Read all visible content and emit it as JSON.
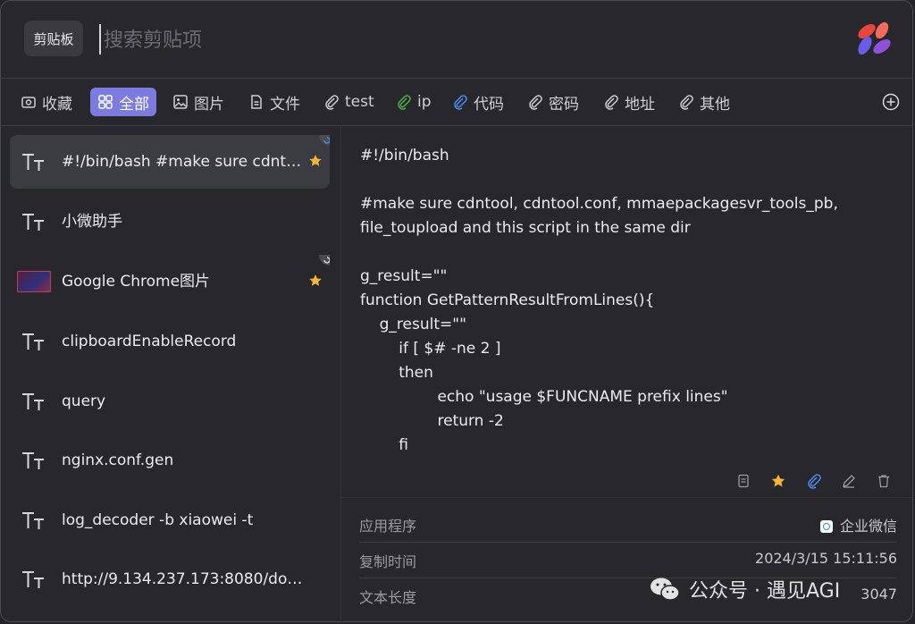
{
  "topbar": {
    "clipboard_chip": "剪贴板",
    "search_placeholder": "搜索剪贴项"
  },
  "tabs": [
    {
      "label": "收藏",
      "icon": "camera-icon"
    },
    {
      "label": "全部",
      "icon": "grid-icon",
      "active": true
    },
    {
      "label": "图片",
      "icon": "image-icon"
    },
    {
      "label": "文件",
      "icon": "file-icon"
    },
    {
      "label": "test",
      "icon": "paperclip-icon"
    },
    {
      "label": "ip",
      "icon": "paperclip-icon",
      "color": "#4caf50"
    },
    {
      "label": "代码",
      "icon": "paperclip-icon",
      "color": "#4a8df0"
    },
    {
      "label": "密码",
      "icon": "paperclip-icon"
    },
    {
      "label": "地址",
      "icon": "paperclip-icon"
    },
    {
      "label": "其他",
      "icon": "paperclip-icon"
    }
  ],
  "list": [
    {
      "label": "#!/bin/bash #make sure cdntool…",
      "icon": "text-icon",
      "starred": true,
      "selected": true
    },
    {
      "label": "小微助手",
      "icon": "text-icon"
    },
    {
      "label": "Google Chrome图片",
      "icon": "image-thumb",
      "starred": true
    },
    {
      "label": "clipboardEnableRecord",
      "icon": "text-icon"
    },
    {
      "label": "query",
      "icon": "text-icon"
    },
    {
      "label": "nginx.conf.gen",
      "icon": "text-icon"
    },
    {
      "label": "log_decoder -b xiaowei -t",
      "icon": "text-icon"
    },
    {
      "label": "http://9.134.237.173:8080/download",
      "icon": "text-icon"
    }
  ],
  "preview": {
    "lines": [
      "#!/bin/bash",
      "",
      "#make sure cdntool, cdntool.conf, mmaepackagesvr_tools_pb,",
      "file_toupload and this script in the same dir",
      "",
      "g_result=\"\"",
      "function GetPatternResultFromLines(){",
      "    g_result=\"\"",
      "        if [ $# -ne 2 ]",
      "        then",
      "                echo \"usage $FUNCNAME prefix lines\"",
      "                return -2",
      "        fi"
    ]
  },
  "meta": {
    "app_label": "应用程序",
    "app_value": "企业微信",
    "time_label": "复制时间",
    "time_value": "2024/3/15 15:11:56",
    "length_label": "文本长度",
    "length_value": "3047"
  },
  "watermark": "公众号 · 遇见AGI",
  "colors": {
    "accent": "#7c7ce0",
    "star": "#f5b731",
    "bg": "#27272c"
  }
}
